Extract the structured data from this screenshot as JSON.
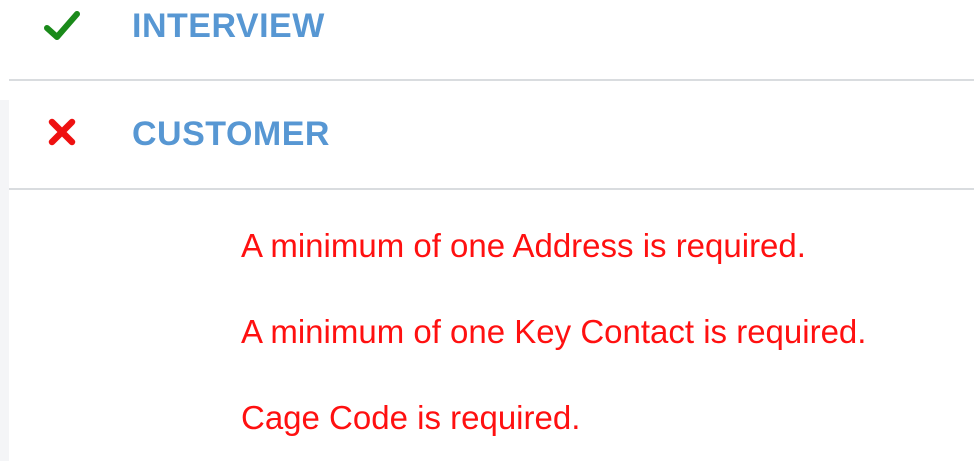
{
  "sections": [
    {
      "title": "INTERVIEW",
      "status": "complete",
      "icon": "checkmark-icon",
      "icon_color": "#1a8a1a"
    },
    {
      "title": "CUSTOMER",
      "status": "error",
      "icon": "x-mark-icon",
      "icon_color": "#ee1111"
    }
  ],
  "customer_errors": [
    "A minimum of one Address is required.",
    "A minimum of one Key Contact is required.",
    "Cage Code is required."
  ],
  "colors": {
    "title": "#5797d3",
    "error_text": "#ff1010",
    "divider": "#d9dcdf"
  }
}
